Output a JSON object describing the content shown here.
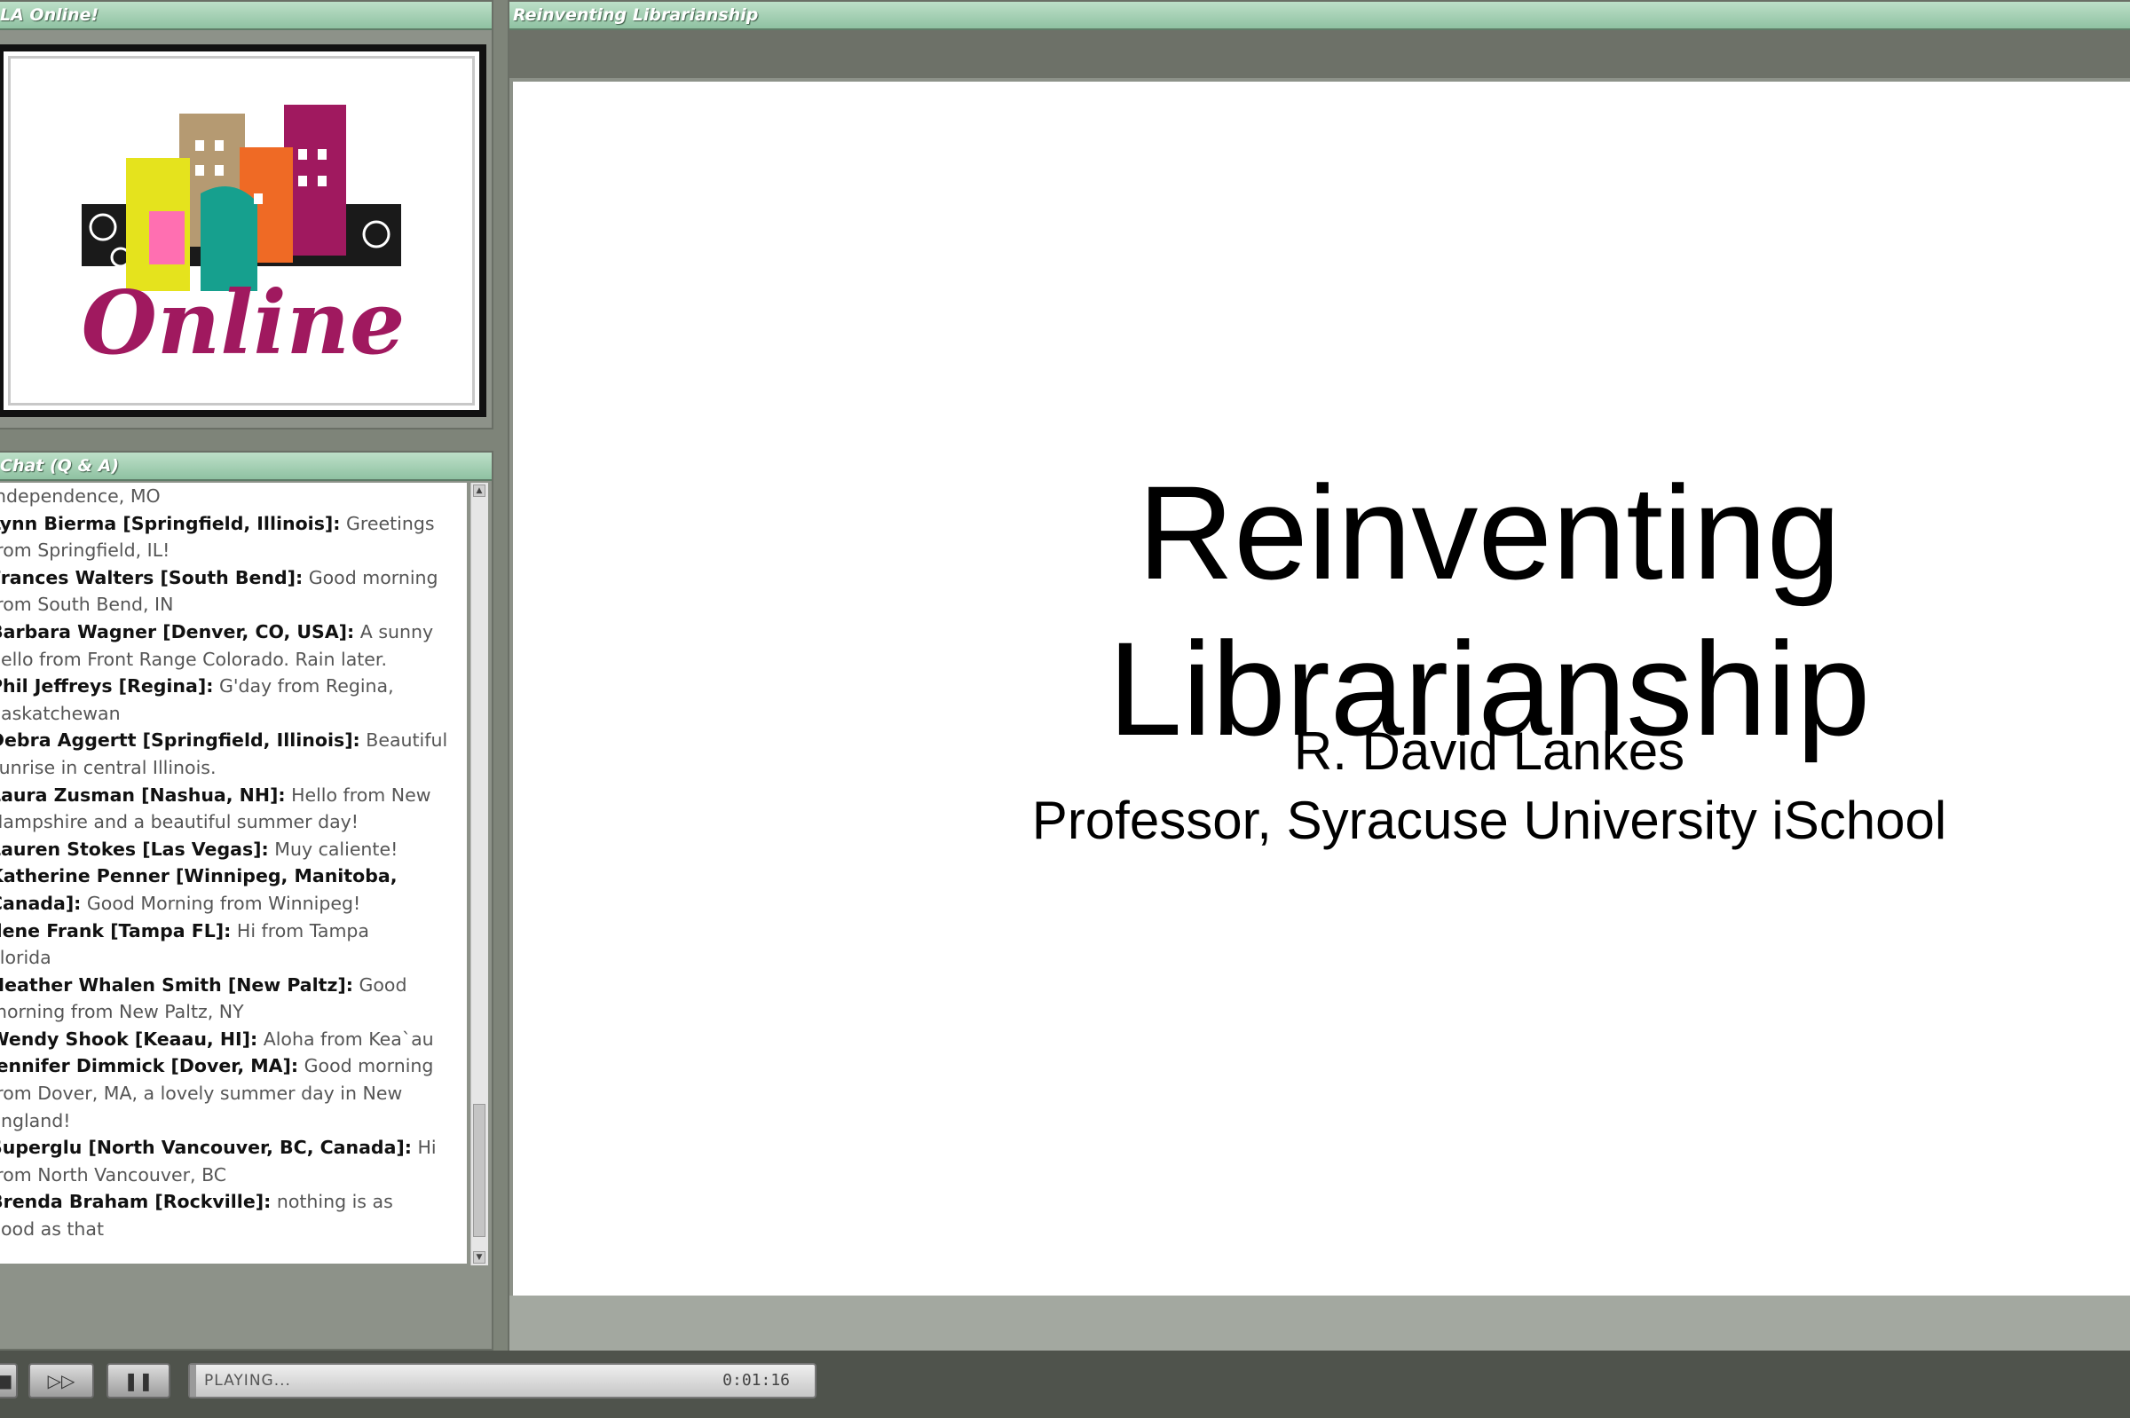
{
  "window": {
    "left_pod_title": "LA Online!",
    "slide_pod_title": "Reinventing Librarianship",
    "chat_pod_title": "Chat (Q & A)"
  },
  "logo": {
    "text": "Online"
  },
  "chat": {
    "messages": [
      {
        "name": "",
        "text": "Independence, MO"
      },
      {
        "name": "Lynn Bierma [Springfield, Illinois]:",
        "text": " Greetings"
      },
      {
        "name": "",
        "text": "from Springfield, IL!"
      },
      {
        "name": "Frances Walters [South Bend]:",
        "text": " Good morning"
      },
      {
        "name": "",
        "text": "from South Bend, IN"
      },
      {
        "name": "Barbara Wagner [Denver, CO, USA]:",
        "text": " A sunny"
      },
      {
        "name": "",
        "text": "hello from Front Range Colorado. Rain later."
      },
      {
        "name": "Phil Jeffreys [Regina]:",
        "text": " G'day from Regina,"
      },
      {
        "name": "",
        "text": "Saskatchewan"
      },
      {
        "name": "Debra Aggertt [Springfield, Illinois]:",
        "text": " Beautiful"
      },
      {
        "name": "",
        "text": "sunrise in central Illinois."
      },
      {
        "name": "Laura Zusman [Nashua, NH]:",
        "text": " Hello from New"
      },
      {
        "name": "",
        "text": "Hampshire and a beautiful summer day!"
      },
      {
        "name": "Lauren Stokes [Las Vegas]:",
        "text": " Muy caliente!"
      },
      {
        "name": "Katherine Penner  [Winnipeg, Manitoba,",
        "text": ""
      },
      {
        "name": "Canada]:",
        "text": " Good Morning from Winnipeg!"
      },
      {
        "name": "Ilene  Frank [Tampa FL]:",
        "text": " Hi from Tampa"
      },
      {
        "name": "",
        "text": "Florida"
      },
      {
        "name": "Heather Whalen Smith [New Paltz]:",
        "text": " Good"
      },
      {
        "name": "",
        "text": "morning from New Paltz, NY"
      },
      {
        "name": "Wendy Shook [Keaau, HI]:",
        "text": " Aloha from Kea`au"
      },
      {
        "name": "Jennifer Dimmick [Dover, MA]:",
        "text": " Good morning"
      },
      {
        "name": "",
        "text": "from Dover, MA, a lovely summer day in New"
      },
      {
        "name": "",
        "text": "England!"
      },
      {
        "name": "Superglu  [North Vancouver, BC, Canada]:",
        "text": " Hi"
      },
      {
        "name": "",
        "text": "from North Vancouver, BC"
      },
      {
        "name": "Brenda Braham [Rockville]:",
        "text": " nothing is as"
      },
      {
        "name": "",
        "text": "good as that"
      }
    ]
  },
  "slide": {
    "title": "Reinventing\nLibrarianship",
    "presenter": "R. David Lankes",
    "affiliation": "Professor, Syracuse University iSchool"
  },
  "player": {
    "status": "PLAYING...",
    "time": "0:01:16",
    "progress": 0.01,
    "buttons": [
      "stop-icon",
      "fast-forward-icon",
      "pause-icon"
    ]
  },
  "colors": {
    "title_bar": "#8fc2a2",
    "background": "#7e8479",
    "slide_bg": "#ffffff"
  }
}
